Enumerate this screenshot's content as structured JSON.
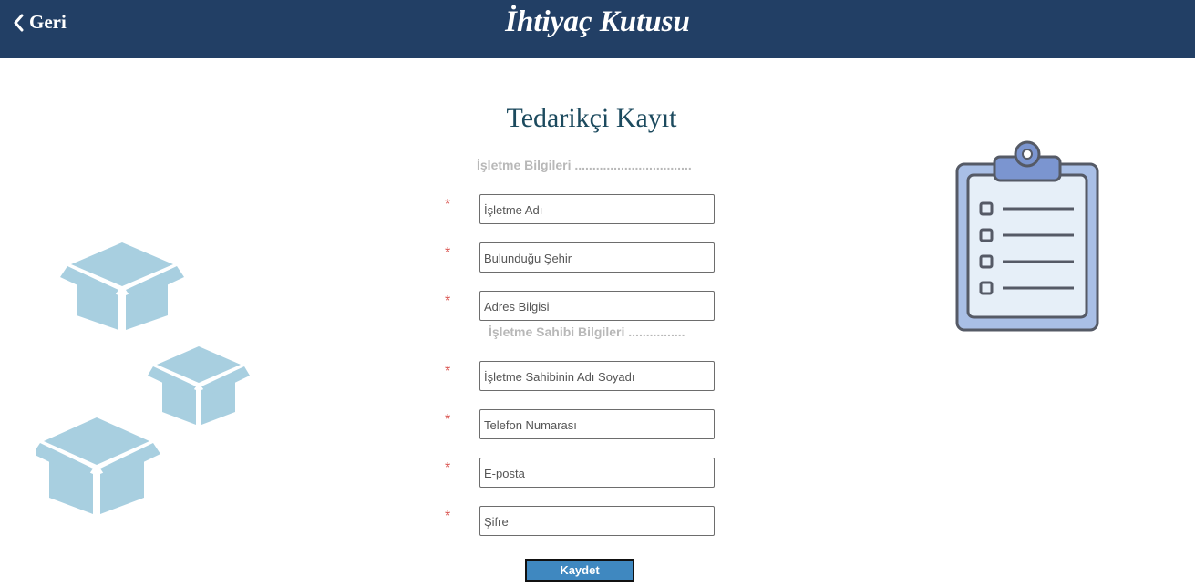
{
  "header": {
    "back_label": "Geri",
    "app_title": "İhtiyaç Kutusu"
  },
  "form": {
    "title": "Tedarikçi Kayıt",
    "required_marker": "*",
    "sections": [
      {
        "heading": "İşletme Bilgileri .................................",
        "fields": [
          {
            "placeholder": "İşletme Adı",
            "value": ""
          },
          {
            "placeholder": "Bulunduğu Şehir",
            "value": ""
          },
          {
            "placeholder": "Adres Bilgisi",
            "value": ""
          }
        ]
      },
      {
        "heading": "İşletme Sahibi Bilgileri ................",
        "fields": [
          {
            "placeholder": "İşletme Sahibinin Adı Soyadı",
            "value": ""
          },
          {
            "placeholder": "Telefon Numarası",
            "value": ""
          },
          {
            "placeholder": "E-posta",
            "value": ""
          },
          {
            "placeholder": "Şifre",
            "value": ""
          }
        ]
      }
    ],
    "submit_label": "Kaydet"
  },
  "colors": {
    "header_bg": "#223f65",
    "title": "#1c4a5e",
    "required": "#d9534f",
    "button": "#3f88c0",
    "box_illustration": "#a8cfe0",
    "clipboard_fill": "#a9bfe6",
    "clipboard_board": "#e6eff8",
    "clipboard_clip": "#7b95d0"
  },
  "icons": {
    "back": "chevron-left-icon",
    "boxes": "boxes-illustration",
    "clipboard": "clipboard-checklist-illustration"
  }
}
